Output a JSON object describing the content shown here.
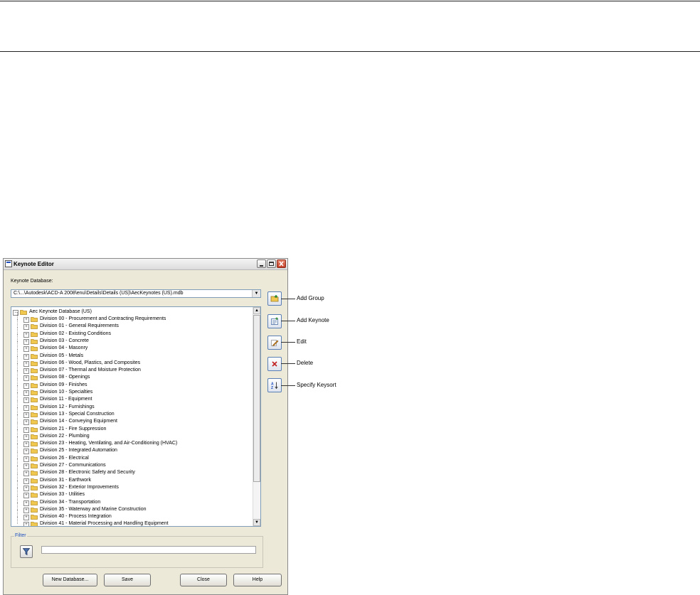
{
  "window": {
    "title": "Keynote Editor"
  },
  "database": {
    "label": "Keynote Database:",
    "path": "C:\\...\\Autodesk\\ACD-A 2008\\enu\\Details\\Details (US)\\AecKeynotes (US).mdb"
  },
  "tree": {
    "root": "Aec Keynote Database (US)",
    "items": [
      "Division 00 - Procurement and Contracting Requirements",
      "Division 01 - General Requirements",
      "Division 02 - Existing Conditions",
      "Division 03 - Concrete",
      "Division 04 - Masonry",
      "Division 05 - Metals",
      "Division 06 - Wood, Plastics, and Composites",
      "Division 07 - Thermal and Moisture Protection",
      "Division 08 - Openings",
      "Division 09 - Finishes",
      "Division 10 - Specialties",
      "Division 11 - Equipment",
      "Division 12 - Furnishings",
      "Division 13 - Special Construction",
      "Division 14 - Conveying Equipment",
      "Division 21 - Fire Suppression",
      "Division 22 - Plumbing",
      "Division 23 - Heating, Ventilating, and Air-Conditioning (HVAC)",
      "Division 25 - Integrated Automation",
      "Division 26 - Electrical",
      "Division 27 - Communications",
      "Division 28 - Electronic Safety and Security",
      "Division 31 - Earthwork",
      "Division 32 - Exterior Improvements",
      "Division 33 - Utilities",
      "Division 34 - Transportation",
      "Division 35 - Waterway and Marine Construction",
      "Division 40 - Process Integration",
      "Division 41 - Material Processing and Handling Equipment"
    ]
  },
  "filter": {
    "label": "Filter",
    "value": ""
  },
  "buttons": {
    "new_database": "New Database...",
    "save": "Save",
    "close": "Close",
    "help": "Help"
  },
  "callouts": {
    "add_group": "Add Group",
    "add_keynote": "Add Keynote",
    "edit": "Edit",
    "delete": "Delete",
    "specify_keysort": "Specify Keysort"
  },
  "icons": {
    "folder": "folder-icon",
    "filter": "funnel-icon",
    "add_group": "add-group-icon",
    "add_keynote": "add-keynote-icon",
    "edit": "pencil-icon",
    "delete": "x-icon",
    "keysort": "sort-az-icon"
  },
  "colors": {
    "accent": "#2050c0",
    "delete": "#c02020",
    "folder": "#f0c850"
  }
}
